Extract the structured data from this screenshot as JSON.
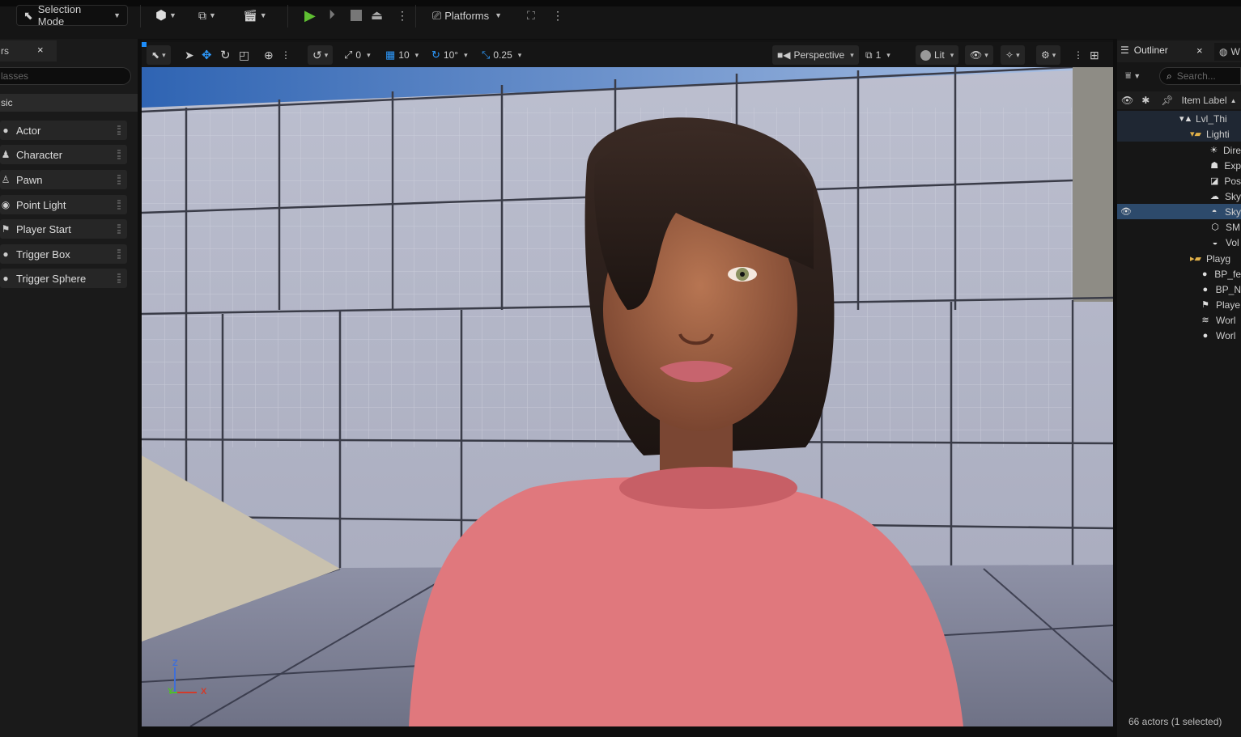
{
  "toolbar": {
    "selection_mode": "Selection Mode",
    "platforms": "Platforms"
  },
  "left_panel": {
    "tab_label": "rs",
    "close": "×",
    "search_placeholder": "lasses",
    "category": "sic",
    "items": [
      "Actor",
      "Character",
      "Pawn",
      "Point Light",
      "Player Start",
      "Trigger Box",
      "Trigger Sphere"
    ]
  },
  "viewport_toolbar": {
    "rotate_snap": "0",
    "grid_snap": "10",
    "angle_snap": "10°",
    "scale_snap": "0.25",
    "view_mode": "Perspective",
    "camera_speed": "1",
    "lit": "Lit"
  },
  "viewport": {
    "axis_z": "Z",
    "axis_y": "Y",
    "axis_x": "X"
  },
  "outliner": {
    "tab": "Outliner",
    "close": "×",
    "second_tab": "W",
    "search_placeholder": "Search...",
    "column": "Item Label",
    "rows": [
      "Lvl_Thi",
      "Lighti",
      "Dire",
      "Exp",
      "Pos",
      "Sky",
      "Sky",
      "SM",
      "Vol",
      "Playg",
      "BP_fe",
      "BP_N",
      "Playe",
      "Worl",
      "Worl"
    ],
    "status": "66 actors (1 selected)"
  },
  "colors": {
    "accent_blue": "#2d4a6b",
    "play_green": "#5fbf32",
    "shirt": "#e0787d"
  }
}
